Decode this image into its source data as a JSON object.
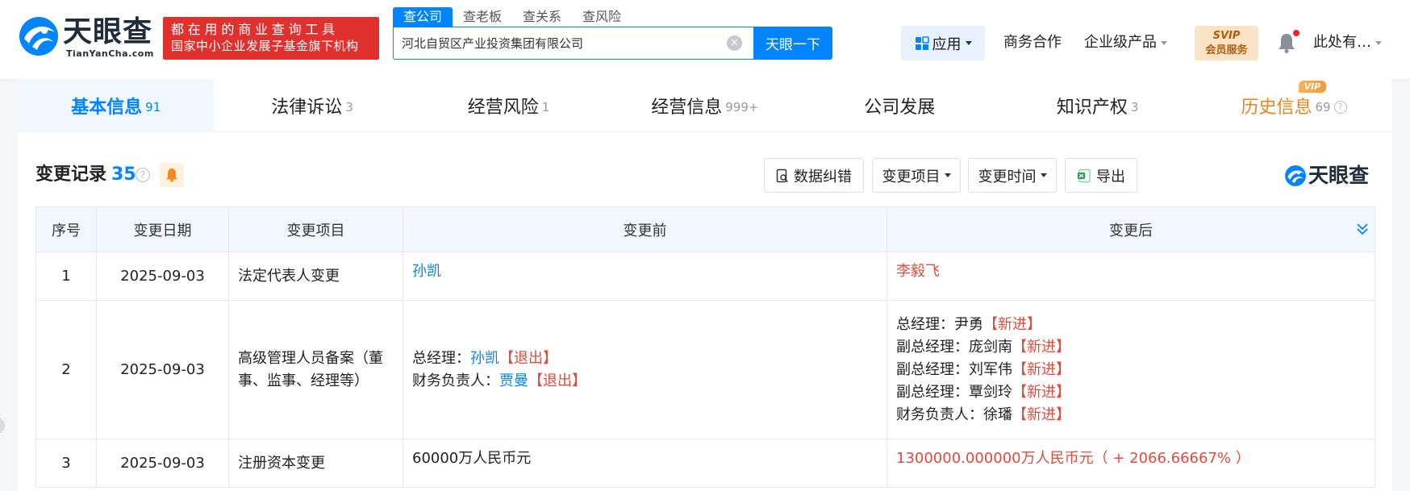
{
  "header": {
    "logo_title": "天眼查",
    "logo_sub": "TianYanCha.com",
    "slogan_line1": "都在用的商业查询工具",
    "slogan_line2": "国家中小企业发展子基金旗下机构",
    "search_tabs": [
      "查公司",
      "查老板",
      "查关系",
      "查风险"
    ],
    "search_value": "河北自贸区产业投资集团有限公司",
    "search_clear_glyph": "×",
    "search_button": "天眼一下",
    "app_label": "应用",
    "nav_business": "商务合作",
    "nav_enterprise": "企业级产品",
    "svip_line1": "SVIP",
    "svip_line2": "会员服务",
    "user_name": "此处有…"
  },
  "tabs": [
    {
      "label": "基本信息",
      "count": "91"
    },
    {
      "label": "法律诉讼",
      "count": "3"
    },
    {
      "label": "经营风险",
      "count": "1"
    },
    {
      "label": "经营信息",
      "count": "999+"
    },
    {
      "label": "公司发展",
      "count": ""
    },
    {
      "label": "知识产权",
      "count": "3"
    },
    {
      "label": "历史信息",
      "count": "69"
    }
  ],
  "vip_tag": "VIP",
  "help_glyph": "?",
  "section": {
    "title": "变更记录",
    "count": "35",
    "btn_correct": "数据纠错",
    "btn_item": "变更项目",
    "btn_time": "变更时间",
    "btn_export": "导出",
    "brand": "天眼查"
  },
  "table": {
    "headers": [
      "序号",
      "变更日期",
      "变更项目",
      "变更前",
      "变更后"
    ],
    "rows": [
      {
        "no": "1",
        "date": "2025-09-03",
        "item": "法定代表人变更",
        "before": "孙凯",
        "after": "李毅飞"
      },
      {
        "no": "2",
        "date": "2025-09-03",
        "item": "高级管理人员备案（董事、监事、经理等）",
        "before": [
          {
            "role": "总经理：",
            "name": "孙凯",
            "tag": "【退出】"
          },
          {
            "role": "财务负责人：",
            "name": "贾曼",
            "tag": "【退出】"
          }
        ],
        "after": [
          {
            "role": "总经理：",
            "name": "尹勇",
            "tag": "【新进】"
          },
          {
            "role": "副总经理：",
            "name": "庞剑南",
            "tag": "【新进】"
          },
          {
            "role": "副总经理：",
            "name": "刘军伟",
            "tag": "【新进】"
          },
          {
            "role": "副总经理：",
            "name": "覃剑玲",
            "tag": "【新进】"
          },
          {
            "role": "财务负责人：",
            "name": "徐璠",
            "tag": "【新进】"
          }
        ]
      },
      {
        "no": "3",
        "date": "2025-09-03",
        "item": "注册资本变更",
        "before": "60000万人民币元",
        "after": "1300000.000000万人民币元（ + 2066.66667% ）"
      }
    ]
  },
  "colors": {
    "brand_blue": "#0084ff",
    "slogan_red": "#e0312f",
    "change_red": "#e24b3b",
    "history_orange": "#e8841a"
  },
  "icons": [
    "search-clear-icon",
    "app-grid-icon",
    "bell-icon",
    "help-icon",
    "notify-bell-icon",
    "correct-icon",
    "excel-icon",
    "expand-chevron-icon"
  ]
}
